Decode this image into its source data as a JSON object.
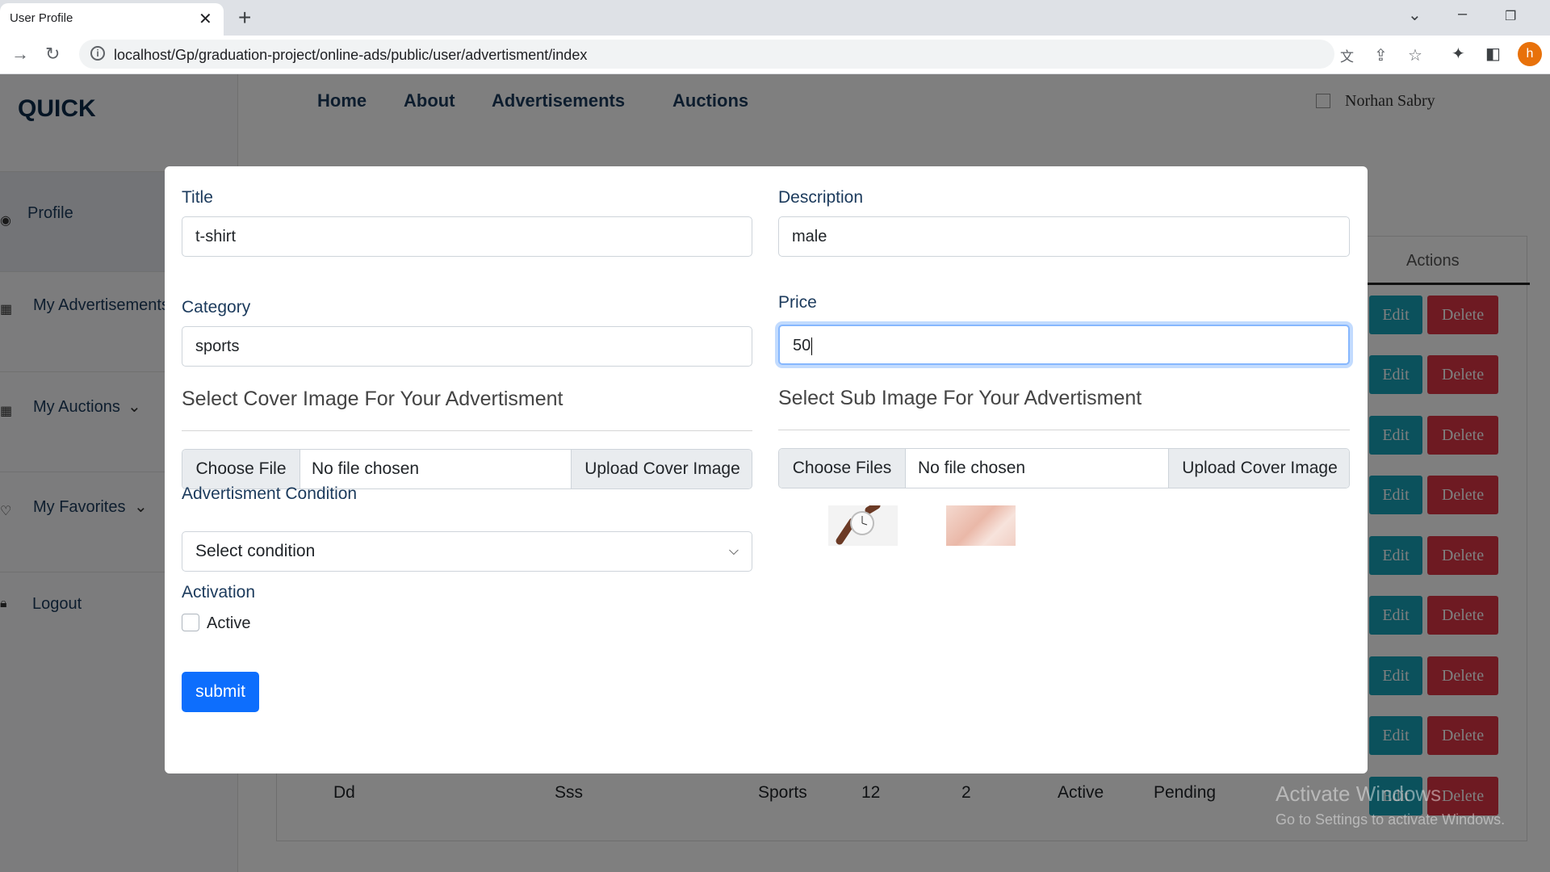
{
  "browser": {
    "tab_title": "User Profile",
    "url": "localhost/Gp/graduation-project/online-ads/public/user/advertisment/index",
    "profile_initial": "h"
  },
  "sidebar": {
    "brand": "QUICK",
    "items": [
      {
        "label": "Profile",
        "icon": "user-circle-icon"
      },
      {
        "label": "My Advertisements",
        "icon": "grid-icon"
      },
      {
        "label": "My Auctions",
        "icon": "grid-icon"
      },
      {
        "label": "My Favorites",
        "icon": "heart-icon"
      },
      {
        "label": "Logout",
        "icon": "lock-icon"
      }
    ]
  },
  "topnav": {
    "items": [
      "Home",
      "About",
      "Advertisements",
      "Auctions"
    ],
    "user_name": "Norhan Sabry"
  },
  "table": {
    "actions_header": "Actions",
    "edit_label": "Edit",
    "delete_label": "Delete",
    "last_row": [
      "Dd",
      "Sss",
      "Sports",
      "12",
      "2",
      "Active",
      "Pending"
    ]
  },
  "watermark": {
    "line1": "Activate Windows",
    "line2": "Go to Settings to activate Windows."
  },
  "modal": {
    "title_label": "Title",
    "title_value": "t-shirt",
    "description_label": "Description",
    "description_value": "male",
    "category_label": "Category",
    "category_value": "sports",
    "price_label": "Price",
    "price_value": "50",
    "cover_heading": "Select Cover Image For Your Advertisment",
    "sub_heading": "Select Sub Image For Your Advertisment",
    "choose_file": "Choose File",
    "choose_files": "Choose Files",
    "no_file": "No file chosen",
    "upload_cover": "Upload Cover Image",
    "condition_label": "Advertisment Condition",
    "condition_value": "Select condition",
    "activation_label": "Activation",
    "active_label": "Active",
    "submit_label": "submit"
  }
}
